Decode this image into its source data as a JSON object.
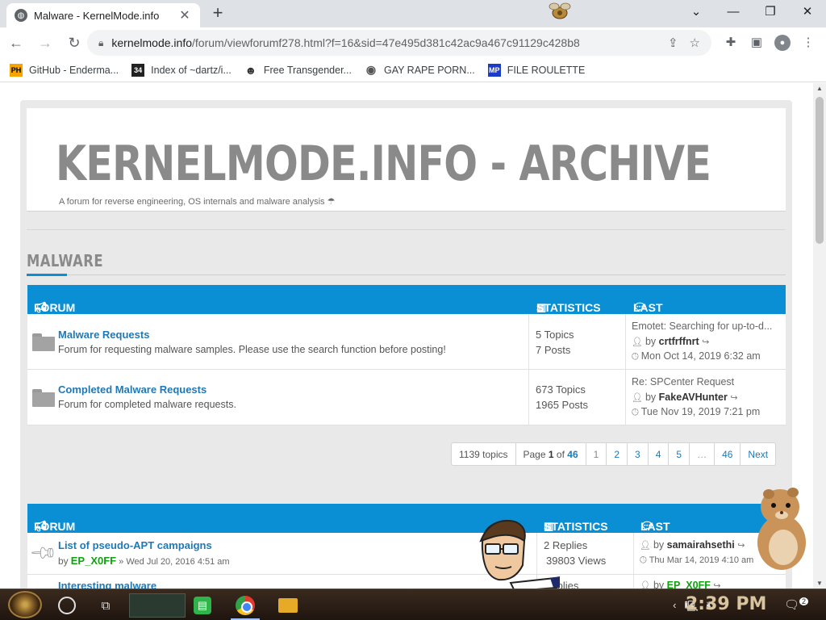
{
  "browser": {
    "tab_title": "Malware - KernelMode.info",
    "tab_close": "✕",
    "new_tab": "+",
    "window_controls": [
      "⌄",
      "—",
      "❐",
      "✕"
    ],
    "nav": {
      "back": "←",
      "forward": "→",
      "reload": "↻"
    },
    "url_host": "kernelmode.info",
    "url_path": "/forum/viewforumf278.html?f=16&sid=47e495d381c42ac9a467c91129c428b8",
    "bookmarks": [
      {
        "label": "GitHub - Enderma...",
        "icon": "PH"
      },
      {
        "label": "Index of ~dartz/i...",
        "icon": "34"
      },
      {
        "label": "Free Transgender...",
        "icon": "☻"
      },
      {
        "label": "GAY RAPE PORN...",
        "icon": "◉"
      },
      {
        "label": "FILE ROULETTE",
        "icon": "MP"
      }
    ]
  },
  "site": {
    "title": "KERNELMODE.INFO - ARCHIVE",
    "description": "A forum for reverse engineering, OS internals and malware analysis ☂"
  },
  "section": {
    "title": "MALWARE"
  },
  "forum_table": {
    "headers": {
      "forum": "FORUM",
      "statistics": "STATISTICS",
      "last_post": "LAST POST"
    },
    "rows": [
      {
        "name": "Malware Requests",
        "description": "Forum for requesting malware samples. Please use the search function before posting!",
        "topics": "5 Topics",
        "posts": "7 Posts",
        "last_title": "Emotet: Searching for up-to-d...",
        "by": "by",
        "last_user": "crtfrffnrt",
        "last_date": "Mon Oct 14, 2019 6:32 am"
      },
      {
        "name": "Completed Malware Requests",
        "description": "Forum for completed malware requests.",
        "topics": "673 Topics",
        "posts": "1965 Posts",
        "last_title": "Re: SPCenter Request",
        "by": "by",
        "last_user": "FakeAVHunter",
        "last_date": "Tue Nov 19, 2019 7:21 pm"
      }
    ]
  },
  "pagination": {
    "topics_count": "1139 topics",
    "page_label": "Page",
    "current": "1",
    "of": "of",
    "total": "46",
    "pages": [
      "1",
      "2",
      "3",
      "4",
      "5",
      "…",
      "46"
    ],
    "next": "Next"
  },
  "topic_table": {
    "headers": {
      "forum": "FORUM",
      "statistics": "STATISTICS",
      "last_post": "LAST POST"
    },
    "rows": [
      {
        "title": "List of pseudo-APT campaigns",
        "by": "by",
        "author": "EP_X0FF",
        "date": "» Wed Jul 20, 2016 4:51 am",
        "replies": "2 Replies",
        "views": "39803 Views",
        "last_user": "samairahsethi",
        "last_date": "Thu Mar 14, 2019 4:10 am"
      },
      {
        "title": "Interesting malware",
        "replies": "Replies",
        "last_user": "EP_X0FF"
      }
    ]
  },
  "taskbar": {
    "clock": "2:39 PM",
    "notifications": "2"
  },
  "colors": {
    "accent": "#0b8fd4",
    "link": "#1e79b6",
    "username_green": "#0fa20f",
    "header_gray": "#8a8a8a"
  }
}
